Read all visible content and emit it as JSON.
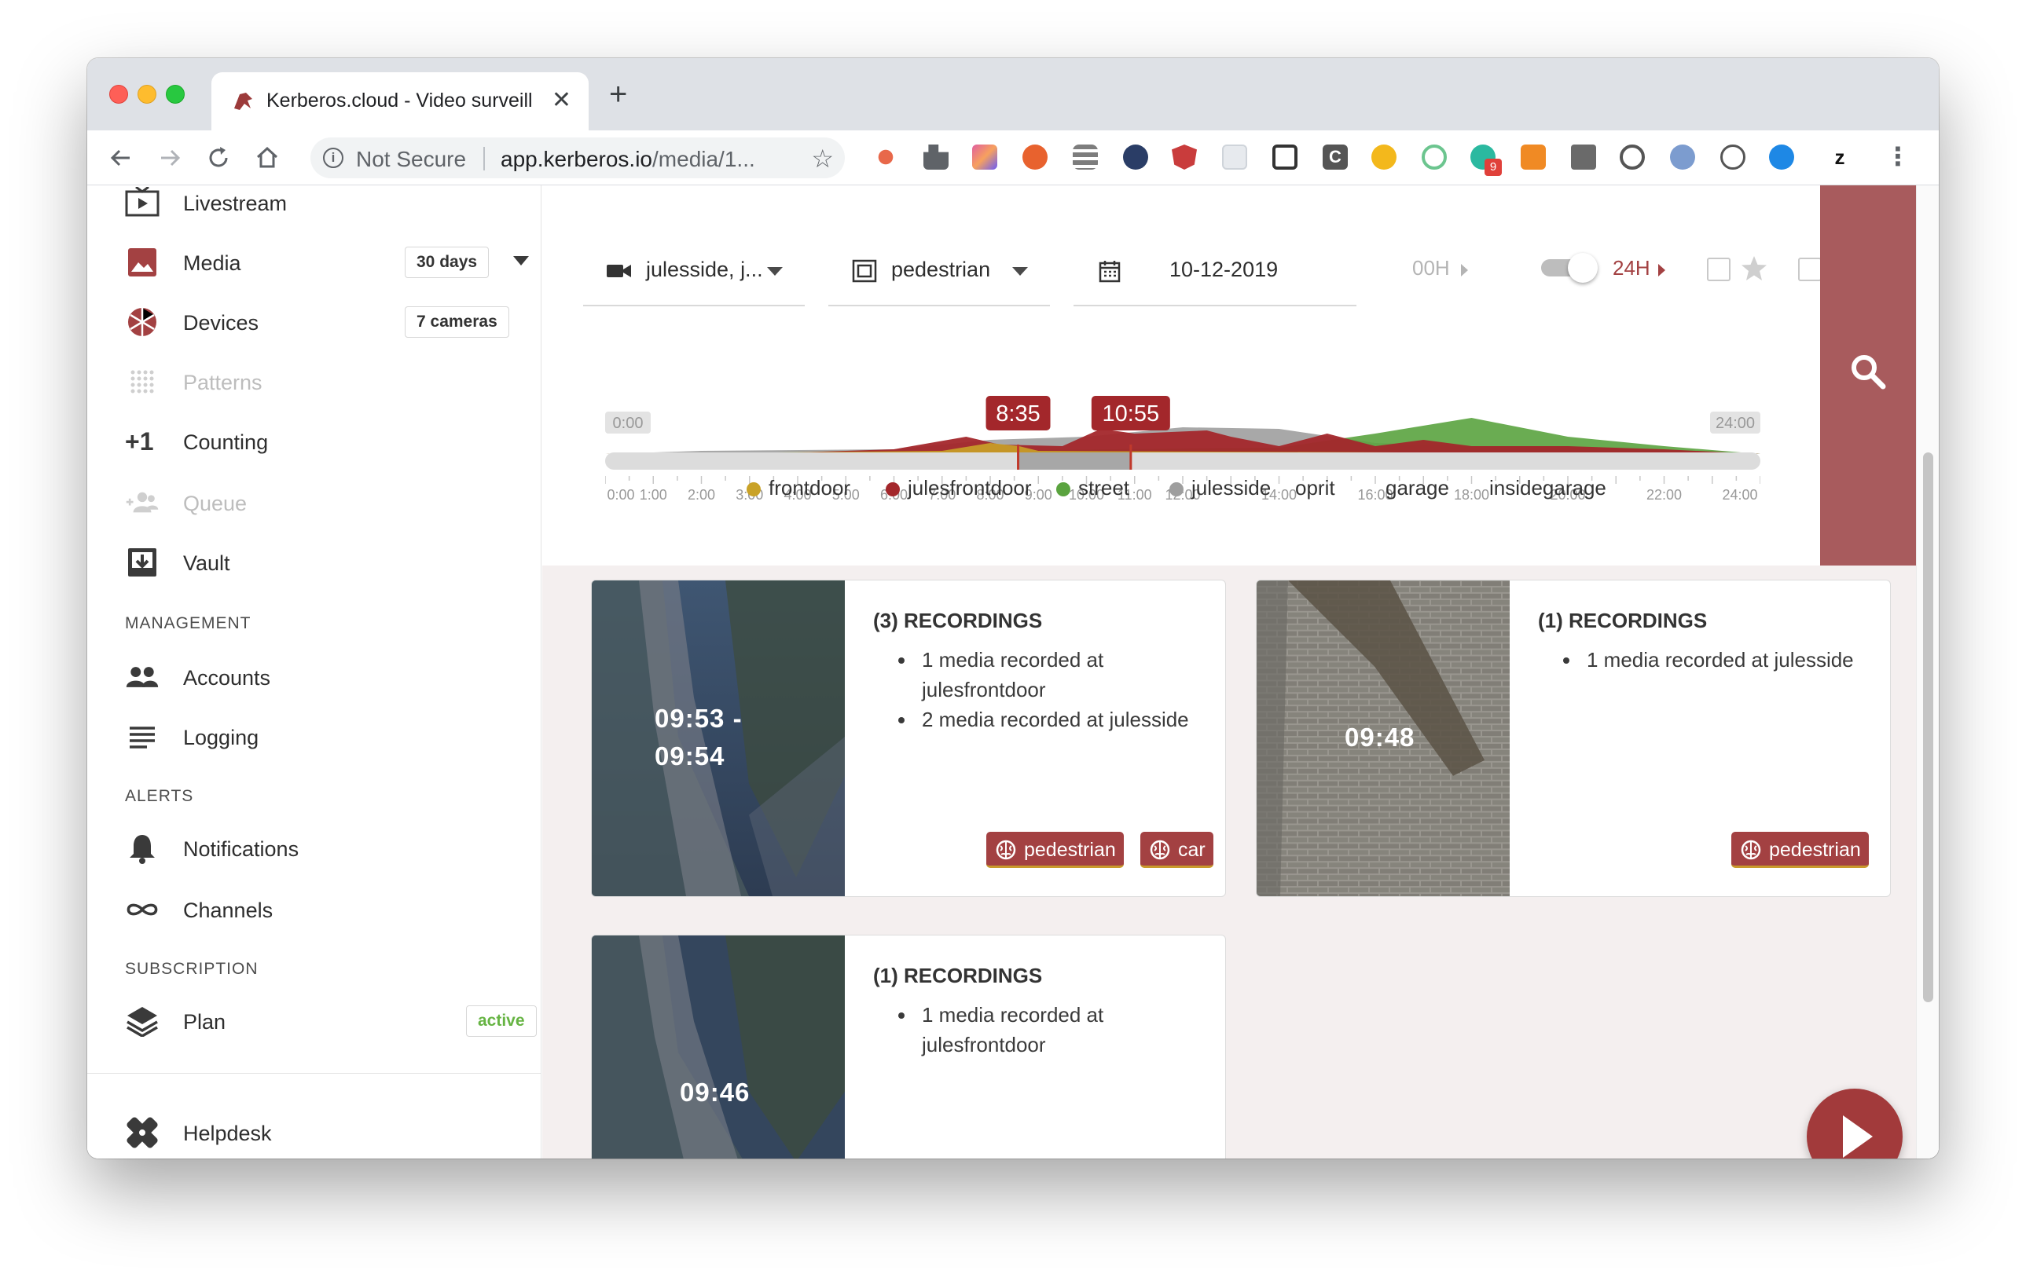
{
  "browser": {
    "tab_title": "Kerberos.cloud - Video surveill",
    "tab_close": "✕",
    "new_tab": "+",
    "security_label": "Not Secure",
    "url_host": "app.kerberos.io",
    "url_path": "/media/1...",
    "extension_badge": "9"
  },
  "sidebar": {
    "items": [
      {
        "label": "Livestream",
        "icon": "livestream-icon"
      },
      {
        "label": "Media",
        "icon": "media-icon",
        "badge": "30 days"
      },
      {
        "label": "Devices",
        "icon": "devices-icon",
        "badge": "7 cameras"
      },
      {
        "label": "Patterns",
        "icon": "patterns-icon"
      },
      {
        "label": "Counting",
        "icon": "counting-icon",
        "icon_text": "+1"
      },
      {
        "label": "Queue",
        "icon": "queue-icon"
      },
      {
        "label": "Vault",
        "icon": "vault-icon"
      }
    ],
    "sections": {
      "management": "MANAGEMENT",
      "alerts": "ALERTS",
      "subscription": "SUBSCRIPTION"
    },
    "management_items": [
      {
        "label": "Accounts",
        "icon": "accounts-icon"
      },
      {
        "label": "Logging",
        "icon": "logging-icon"
      }
    ],
    "alert_items": [
      {
        "label": "Notifications",
        "icon": "bell-icon"
      },
      {
        "label": "Channels",
        "icon": "channels-icon"
      }
    ],
    "subscription_items": [
      {
        "label": "Plan",
        "icon": "plan-icon",
        "badge": "active"
      }
    ],
    "helpdesk": {
      "label": "Helpdesk",
      "icon": "helpdesk-icon"
    }
  },
  "filters": {
    "camera": "julesside, j...",
    "classification": "pedestrian",
    "date": "10-12-2019",
    "range_start": "00H",
    "range_end": "24H",
    "range_start_color": "#b4b4b4",
    "range_end_color": "#a34142"
  },
  "timeline": {
    "start_label": "0:00",
    "end_label": "24:00",
    "selection_start": "8:35",
    "selection_end": "10:55",
    "selection_start_hour": 8.58,
    "selection_end_hour": 10.92,
    "ticks_left": [
      "0:00",
      "1:00",
      "2:00",
      "3:00",
      "4:00",
      "5:00",
      "6:00",
      "7:00",
      "8:00",
      "9:00",
      "10:00",
      "11:00",
      "12:00"
    ],
    "ticks_right": [
      "14:00",
      "16:00",
      "18:00",
      "20:00",
      "22:00",
      "24:00"
    ],
    "legend": [
      {
        "label": "frontdoor",
        "color": "#c9a227"
      },
      {
        "label": "julesfrontdoor",
        "color": "#a3272b"
      },
      {
        "label": "street",
        "color": "#5aa33f"
      },
      {
        "label": "julesside",
        "color": "#9e9e9e"
      },
      {
        "label": "oprit",
        "color": ""
      },
      {
        "label": "garage",
        "color": ""
      },
      {
        "label": "insidegarage",
        "color": ""
      }
    ]
  },
  "cards": [
    {
      "time": "09:53 -\n09:54",
      "title": "(3) RECORDINGS",
      "items": [
        "1 media recorded at julesfrontdoor",
        "2 media recorded at julesside"
      ],
      "tags": [
        "pedestrian",
        "car"
      ]
    },
    {
      "time": "09:48",
      "title": "(1) RECORDINGS",
      "items": [
        "1 media recorded at julesside"
      ],
      "tags": [
        "pedestrian"
      ]
    },
    {
      "time": "09:46",
      "title": "(1) RECORDINGS",
      "items": [
        "1 media recorded at julesfrontdoor"
      ],
      "tags": []
    }
  ],
  "colors": {
    "accent": "#a34142",
    "search_panel": "#a85b5d",
    "background": "#f4efef"
  }
}
